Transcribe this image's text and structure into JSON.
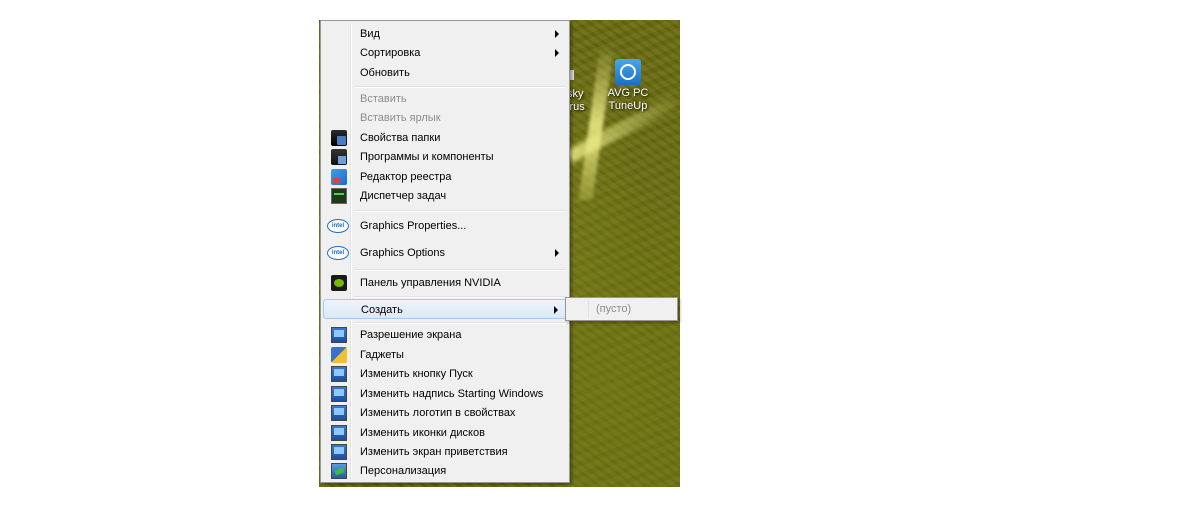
{
  "desktop": {
    "icons": [
      {
        "label_line1": "AVG PC",
        "label_line2": "TuneUp",
        "icon": "avg-tuneup-icon"
      }
    ],
    "partial_icon_text_line1": "sky",
    "partial_icon_text_line2": "irus"
  },
  "context_menu": {
    "items": [
      {
        "label": "Вид",
        "submenu": true
      },
      {
        "label": "Сортировка",
        "submenu": true
      },
      {
        "label": "Обновить"
      },
      {
        "label": "Вставить",
        "disabled": true
      },
      {
        "label": "Вставить ярлык",
        "disabled": true
      },
      {
        "label": "Свойства папки",
        "icon": "folder-options-icon"
      },
      {
        "label": "Программы и компоненты",
        "icon": "programs-icon"
      },
      {
        "label": "Редактор реестра",
        "icon": "registry-editor-icon"
      },
      {
        "label": "Диспетчер задач",
        "icon": "task-manager-icon"
      },
      {
        "label": "Graphics Properties...",
        "icon": "intel-icon"
      },
      {
        "label": "Graphics Options",
        "icon": "intel-icon",
        "submenu": true
      },
      {
        "label": "Панель управления NVIDIA",
        "icon": "nvidia-icon"
      },
      {
        "label": "Создать",
        "submenu": true,
        "highlighted": true
      },
      {
        "label": "Разрешение экрана",
        "icon": "monitor-icon"
      },
      {
        "label": "Гаджеты",
        "icon": "gadgets-icon"
      },
      {
        "label": "Изменить кнопку Пуск",
        "icon": "monitor-icon"
      },
      {
        "label": "Изменить надпись Starting Windows",
        "icon": "monitor-icon"
      },
      {
        "label": "Изменить логотип в свойствах",
        "icon": "monitor-icon"
      },
      {
        "label": "Изменить иконки дисков",
        "icon": "monitor-icon"
      },
      {
        "label": "Изменить экран приветствия",
        "icon": "monitor-icon"
      },
      {
        "label": "Персонализация",
        "icon": "personalization-icon"
      }
    ],
    "intel_icon_text": "intel"
  },
  "submenu_create": {
    "items": [
      {
        "label": "(пусто)",
        "disabled": true
      }
    ]
  }
}
